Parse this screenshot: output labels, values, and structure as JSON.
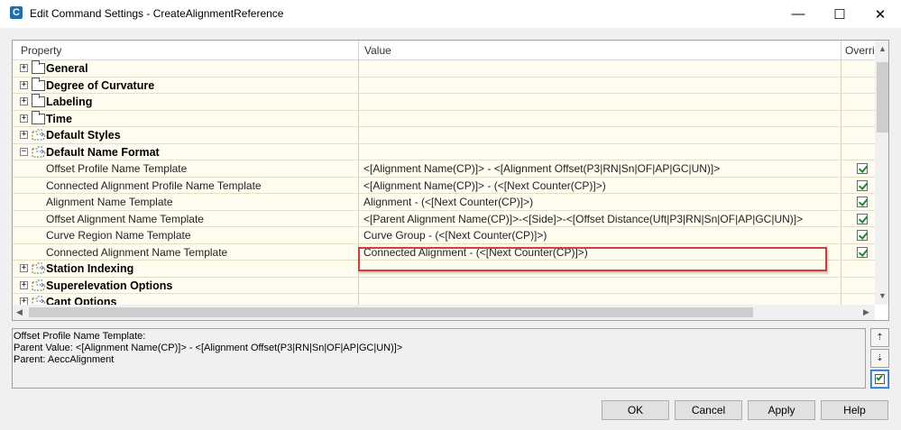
{
  "window": {
    "icon_letter": "C",
    "title": "Edit Command Settings - CreateAlignmentReference",
    "minimize_glyph": "—",
    "maximize_glyph": "☐",
    "close_glyph": "✕"
  },
  "grid": {
    "columns": [
      "Property",
      "Value",
      "Overri"
    ],
    "rows": [
      {
        "kind": "category",
        "expander": "+",
        "icon": "folder-icon",
        "label": "General"
      },
      {
        "kind": "category",
        "expander": "+",
        "icon": "folder-icon",
        "label": "Degree of Curvature"
      },
      {
        "kind": "category",
        "expander": "+",
        "icon": "folder-icon",
        "label": "Labeling"
      },
      {
        "kind": "category",
        "expander": "+",
        "icon": "folder-icon",
        "label": "Time"
      },
      {
        "kind": "category",
        "expander": "+",
        "icon": "dashed-folder-icon",
        "label": "Default Styles"
      },
      {
        "kind": "category",
        "expander": "−",
        "icon": "dashed-folder-icon",
        "label": "Default Name Format"
      },
      {
        "kind": "property",
        "label": "Offset Profile Name Template",
        "value": "<[Alignment Name(CP)]> - <[Alignment Offset(P3|RN|Sn|OF|AP|GC|UN)]>",
        "override": true
      },
      {
        "kind": "property",
        "label": "Connected Alignment Profile Name Template",
        "value": "<[Alignment Name(CP)]> -  (<[Next Counter(CP)]>)",
        "override": true
      },
      {
        "kind": "property",
        "label": "Alignment Name Template",
        "value": "Alignment - (<[Next Counter(CP)]>)",
        "override": true
      },
      {
        "kind": "property",
        "label": "Offset Alignment Name Template",
        "value": "<[Parent Alignment Name(CP)]>-<[Side]>-<[Offset Distance(Uft|P3|RN|Sn|OF|AP|GC|UN)]>",
        "override": true
      },
      {
        "kind": "property",
        "label": "Curve Region Name Template",
        "value": "Curve Group - (<[Next Counter(CP)]>)",
        "override": true
      },
      {
        "kind": "property",
        "label": "Connected Alignment Name Template",
        "value": "Connected Alignment - (<[Next Counter(CP)]>)",
        "override": true
      },
      {
        "kind": "category",
        "expander": "+",
        "icon": "dashed-folder-icon",
        "label": "Station Indexing"
      },
      {
        "kind": "category",
        "expander": "+",
        "icon": "dashed-folder-icon",
        "label": "Superelevation Options"
      },
      {
        "kind": "category",
        "expander": "+",
        "icon": "dashed-folder-icon",
        "label": "Cant Options"
      }
    ]
  },
  "description": {
    "line1": "Offset Profile Name Template:",
    "line2": "Parent Value: <[Alignment Name(CP)]> - <[Alignment Offset(P3|RN|Sn|OF|AP|GC|UN)]>",
    "line3": "Parent: AeccAlignment"
  },
  "buttons": {
    "ok": "OK",
    "cancel": "Cancel",
    "apply": "Apply",
    "help": "Help"
  },
  "colors": {
    "highlight_border": "#d93a3a",
    "row_background": "#fefdf0",
    "check_green": "#1b8a2a"
  }
}
